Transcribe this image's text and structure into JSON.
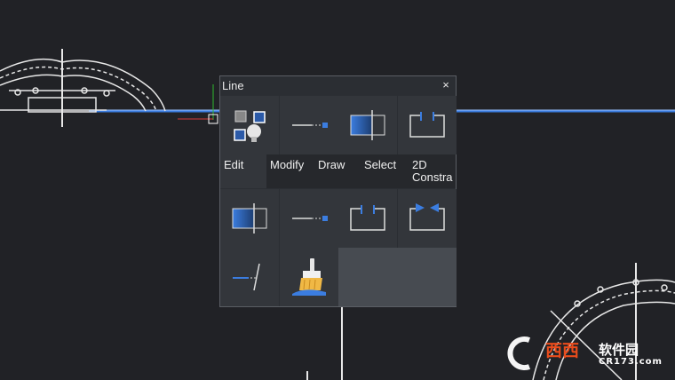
{
  "panel": {
    "title": "Line",
    "close_glyph": "×"
  },
  "tabs": [
    {
      "label": "Edit",
      "active": true
    },
    {
      "label": "Modify",
      "active": false
    },
    {
      "label": "Draw",
      "active": false
    },
    {
      "label": "Select",
      "active": false
    },
    {
      "label": "2D\nConstra",
      "active": false
    }
  ],
  "tools_row1": [
    {
      "icon": "layer-visibility-icon"
    },
    {
      "icon": "extend-line-icon"
    },
    {
      "icon": "trim-box-icon"
    },
    {
      "icon": "break-bracket-icon"
    }
  ],
  "tools_row2": [
    {
      "icon": "trim-box-icon"
    },
    {
      "icon": "extend-line-icon"
    },
    {
      "icon": "break-bracket-icon"
    },
    {
      "icon": "join-arrows-icon"
    }
  ],
  "tools_row3": [
    {
      "icon": "fillet-line-icon"
    },
    {
      "icon": "cleanup-brush-icon"
    }
  ],
  "watermark": {
    "main": "西西",
    "site": "软件园",
    "domain": "CR173.com"
  },
  "colors": {
    "background": "#212226",
    "accent": "#3b7de0",
    "panel": "#2b2e33"
  }
}
